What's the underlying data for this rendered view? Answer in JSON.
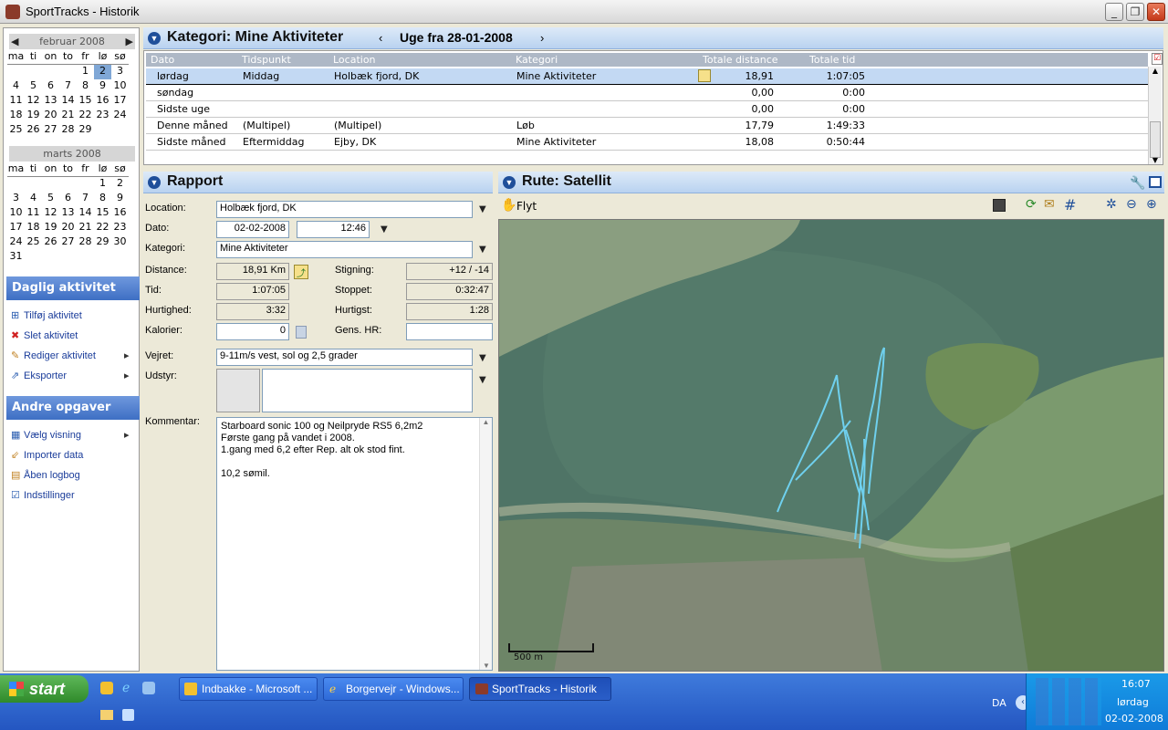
{
  "window": {
    "title": "SportTracks - Historik"
  },
  "calendar": [
    {
      "month": "februar 2008",
      "days_header": [
        "ma",
        "ti",
        "on",
        "to",
        "fr",
        "lø",
        "sø"
      ],
      "weeks": [
        [
          "",
          "",
          "",
          "",
          "1",
          "2",
          "3"
        ],
        [
          "4",
          "5",
          "6",
          "7",
          "8",
          "9",
          "10"
        ],
        [
          "11",
          "12",
          "13",
          "14",
          "15",
          "16",
          "17"
        ],
        [
          "18",
          "19",
          "20",
          "21",
          "22",
          "23",
          "24"
        ],
        [
          "25",
          "26",
          "27",
          "28",
          "29",
          "",
          ""
        ]
      ],
      "selected": "2"
    },
    {
      "month": "marts 2008",
      "days_header": [
        "ma",
        "ti",
        "on",
        "to",
        "fr",
        "lø",
        "sø"
      ],
      "weeks": [
        [
          "",
          "",
          "",
          "",
          "",
          "1",
          "2"
        ],
        [
          "3",
          "4",
          "5",
          "6",
          "7",
          "8",
          "9"
        ],
        [
          "10",
          "11",
          "12",
          "13",
          "14",
          "15",
          "16"
        ],
        [
          "17",
          "18",
          "19",
          "20",
          "21",
          "22",
          "23"
        ],
        [
          "24",
          "25",
          "26",
          "27",
          "28",
          "29",
          "30"
        ],
        [
          "31",
          "",
          "",
          "",
          "",
          "",
          ""
        ]
      ],
      "selected": ""
    }
  ],
  "daily": {
    "title": "Daglig aktivitet",
    "items": [
      "Tilføj aktivitet",
      "Slet aktivitet",
      "Rediger aktivitet",
      "Eksporter"
    ]
  },
  "other": {
    "title": "Andre opgaver",
    "items": [
      "Vælg visning",
      "Importer data",
      "Åben logbog",
      "Indstillinger"
    ]
  },
  "category_bar": {
    "title": "Kategori: Mine Aktiviteter",
    "week": "Uge fra 28-01-2008"
  },
  "table": {
    "headers": [
      "Dato",
      "Tidspunkt",
      "Location",
      "Kategori",
      "Totale distance",
      "Totale tid"
    ],
    "rows": [
      {
        "dato": "lørdag",
        "tid": "Middag",
        "loc": "Holbæk fjord, DK",
        "kat": "Mine Aktiviteter",
        "dist": "18,91",
        "total": "1:07:05"
      },
      {
        "dato": "søndag",
        "tid": "",
        "loc": "",
        "kat": "",
        "dist": "0,00",
        "total": "0:00"
      },
      {
        "dato": "Sidste uge",
        "tid": "",
        "loc": "",
        "kat": "",
        "dist": "0,00",
        "total": "0:00"
      },
      {
        "dato": "Denne måned",
        "tid": "(Multipel)",
        "loc": "(Multipel)",
        "kat": "Løb",
        "dist": "17,79",
        "total": "1:49:33"
      },
      {
        "dato": "Sidste måned",
        "tid": "Eftermiddag",
        "loc": "Ejby, DK",
        "kat": "Mine Aktiviteter",
        "dist": "18,08",
        "total": "0:50:44"
      }
    ]
  },
  "report": {
    "title": "Rapport",
    "location_label": "Location:",
    "location": "Holbæk fjord, DK",
    "date_label": "Dato:",
    "date": "02-02-2008",
    "time": "12:46",
    "category_label": "Kategori:",
    "category": "Mine Aktiviteter",
    "distance_label": "Distance:",
    "distance": "18,91 Km",
    "climb_label": "Stigning:",
    "climb": "+12 / -14",
    "time_label": "Tid:",
    "duration": "1:07:05",
    "stopped_label": "Stoppet:",
    "stopped": "0:32:47",
    "speed_label": "Hurtighed:",
    "speed": "3:32",
    "fastest_label": "Hurtigst:",
    "fastest": "1:28",
    "calories_label": "Kalorier:",
    "calories": "0",
    "avg_hr_label": "Gens. HR:",
    "avg_hr": "",
    "weather_label": "Vejret:",
    "weather": "9-11m/s vest,  sol og 2,5 grader",
    "equipment_label": "Udstyr:",
    "comment_label": "Kommentar:",
    "comment_lines": [
      "Starboard sonic 100 og Neilpryde RS5 6,2m2",
      "Første gang på vandet i 2008.",
      "1.gang med 6,2 efter Rep. alt ok stod fint.",
      "",
      "10,2 sømil."
    ]
  },
  "route": {
    "title": "Rute: Satellit",
    "move_label": "Flyt",
    "scale": "500 m"
  },
  "taskbar": {
    "start": "start",
    "buttons": [
      "Indbakke - Microsoft ...",
      "Borgervejr - Windows...",
      "SportTracks - Historik"
    ],
    "lang": "DA",
    "clock_time": "16:07",
    "clock_day": "lørdag",
    "clock_date": "02-02-2008"
  },
  "colors": {
    "accent": "#3e6fc4",
    "selection": "#c3d9f3",
    "track": "#6fd0ee"
  }
}
